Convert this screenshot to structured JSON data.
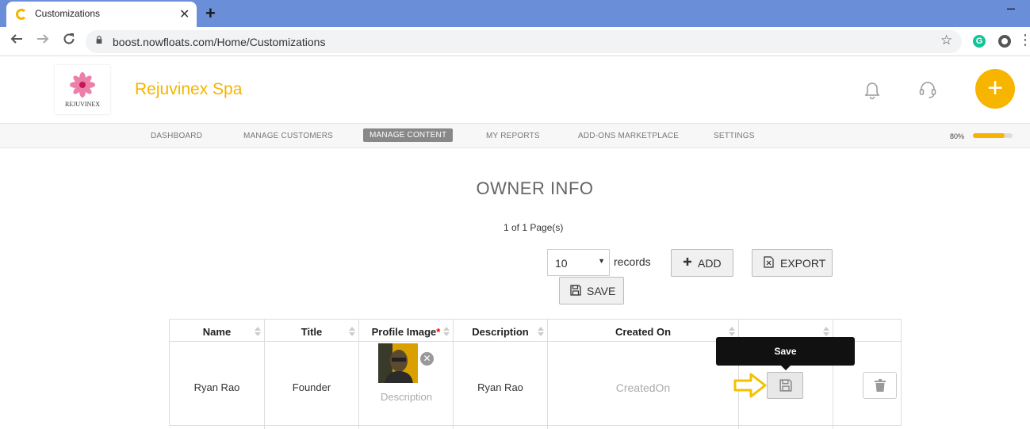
{
  "browser": {
    "tab_title": "Customizations",
    "tab_close": "✕",
    "new_tab": "+",
    "minimize": "–",
    "url": "boost.nowfloats.com/Home/Customizations",
    "ext_g": "G"
  },
  "header": {
    "logo_text": "REJUVINEX",
    "brand_name": "Rejuvinex Spa",
    "fab_symbol": "+",
    "accent_color": "#f6b400"
  },
  "nav": {
    "items": [
      {
        "label": "DASHBOARD",
        "active": false
      },
      {
        "label": "MANAGE CUSTOMERS",
        "active": false
      },
      {
        "label": "MANAGE CONTENT",
        "active": true
      },
      {
        "label": "MY REPORTS",
        "active": false
      },
      {
        "label": "ADD-ONS MARKETPLACE",
        "active": false
      },
      {
        "label": "SETTINGS",
        "active": false
      }
    ],
    "progress_label": "80%",
    "progress_value": 0.8
  },
  "content": {
    "title": "OWNER INFO",
    "pager": "1 of 1 Page(s)",
    "page_size": "10",
    "records_label": "records",
    "add_label": "ADD",
    "export_label": "EXPORT",
    "save_label": "SAVE"
  },
  "table": {
    "columns": [
      "Name",
      "Title",
      "Profile Image",
      "Description",
      "Created On"
    ],
    "required_mark": "*",
    "rows": [
      {
        "name": "Ryan Rao",
        "title": "Founder",
        "image_description_placeholder": "Description",
        "description": "Ryan Rao",
        "created_on": "CreatedOn"
      }
    ]
  },
  "tooltip": {
    "text": "Save"
  }
}
